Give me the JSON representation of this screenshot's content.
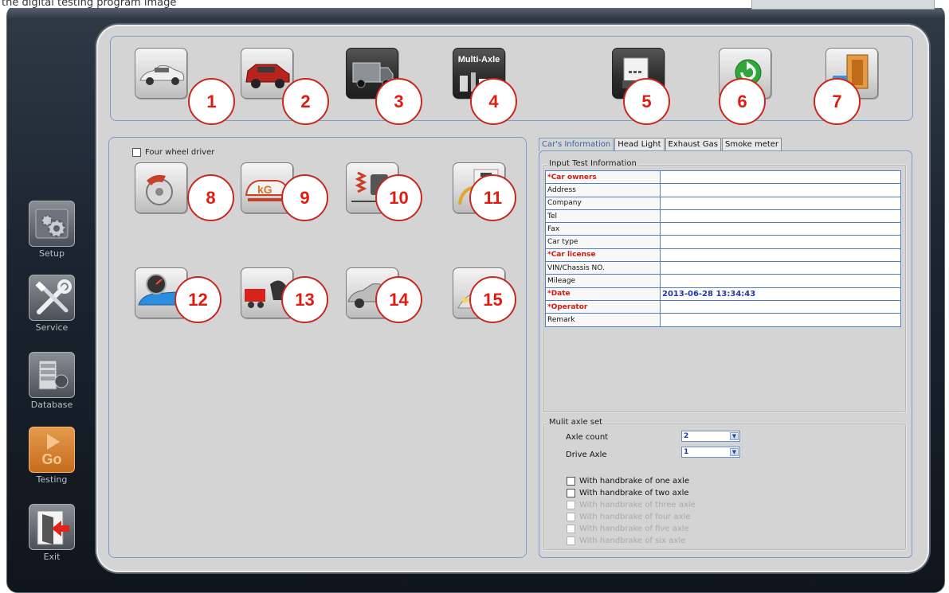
{
  "top_caption": "the digital testing program image",
  "sidebar": {
    "items": [
      {
        "label": "Setup",
        "icon": "gear-icon"
      },
      {
        "label": "Service",
        "icon": "tools-icon"
      },
      {
        "label": "Database",
        "icon": "database-icon"
      },
      {
        "label": "Testing",
        "icon": "go-icon",
        "icon_text": "Go"
      },
      {
        "label": "Exit",
        "icon": "exit-icon"
      }
    ]
  },
  "toolbar": {
    "buttons": [
      {
        "badge": "1",
        "icon": "sedan-icon"
      },
      {
        "badge": "2",
        "icon": "suv-icon"
      },
      {
        "badge": "3",
        "icon": "truck-icon"
      },
      {
        "badge": "4",
        "icon": "multi-axle-icon",
        "icon_text": "Multi-Axle"
      },
      {
        "badge": "5",
        "icon": "printer-icon"
      },
      {
        "badge": "6",
        "icon": "refresh-icon"
      },
      {
        "badge": "7",
        "icon": "door-exit-icon"
      }
    ]
  },
  "left_panel": {
    "four_wheel_label": "Four wheel driver",
    "four_wheel_checked": false,
    "tests": [
      {
        "badge": "8",
        "icon": "brake-disc-icon"
      },
      {
        "badge": "9",
        "icon": "weight-car-icon"
      },
      {
        "badge": "10",
        "icon": "suspension-icon"
      },
      {
        "badge": "11",
        "icon": "sideslip-gauge-icon"
      },
      {
        "badge": "12",
        "icon": "speedometer-car-icon"
      },
      {
        "badge": "13",
        "icon": "trailer-icon"
      },
      {
        "badge": "14",
        "icon": "car-side-icon"
      },
      {
        "badge": "15",
        "icon": "headlight-beam-icon"
      }
    ]
  },
  "tabs": [
    "Car's Information",
    "Head Light",
    "Exhaust Gas",
    "Smoke meter"
  ],
  "active_tab": "Car's Information",
  "info": {
    "group_title": "Input Test Information",
    "rows": [
      {
        "label": "*Car owners",
        "value": "",
        "required": true
      },
      {
        "label": "Address",
        "value": "",
        "required": false
      },
      {
        "label": "Company",
        "value": "",
        "required": false
      },
      {
        "label": "Tel",
        "value": "",
        "required": false
      },
      {
        "label": "Fax",
        "value": "",
        "required": false
      },
      {
        "label": "Car type",
        "value": "",
        "required": false
      },
      {
        "label": "*Car license",
        "value": "",
        "required": true
      },
      {
        "label": "VIN/Chassis NO.",
        "value": "",
        "required": false
      },
      {
        "label": "Mileage",
        "value": "",
        "required": false
      },
      {
        "label": "*Date",
        "value": "2013-06-28 13:34:43",
        "required": true
      },
      {
        "label": "*Operator",
        "value": "",
        "required": true
      },
      {
        "label": "Remark",
        "value": "",
        "required": false
      }
    ]
  },
  "axle": {
    "group_title": "Mulit axle set",
    "axle_count_label": "Axle count",
    "axle_count_value": "2",
    "drive_axle_label": "Drive Axle",
    "drive_axle_value": "1",
    "handbrake": [
      {
        "label": "With handbrake of one axle",
        "enabled": true,
        "checked": false
      },
      {
        "label": "With handbrake of two axle",
        "enabled": true,
        "checked": false
      },
      {
        "label": "With handbrake of three axle",
        "enabled": false,
        "checked": false
      },
      {
        "label": "With handbrake of four axle",
        "enabled": false,
        "checked": false
      },
      {
        "label": "With handbrake of five axle",
        "enabled": false,
        "checked": false
      },
      {
        "label": "With handbrake of six axle",
        "enabled": false,
        "checked": false
      }
    ]
  },
  "colors": {
    "badge_red": "#e01c12",
    "panel_border": "#7a9ad0",
    "required_red": "#d21a10",
    "value_blue": "#2338a8"
  }
}
